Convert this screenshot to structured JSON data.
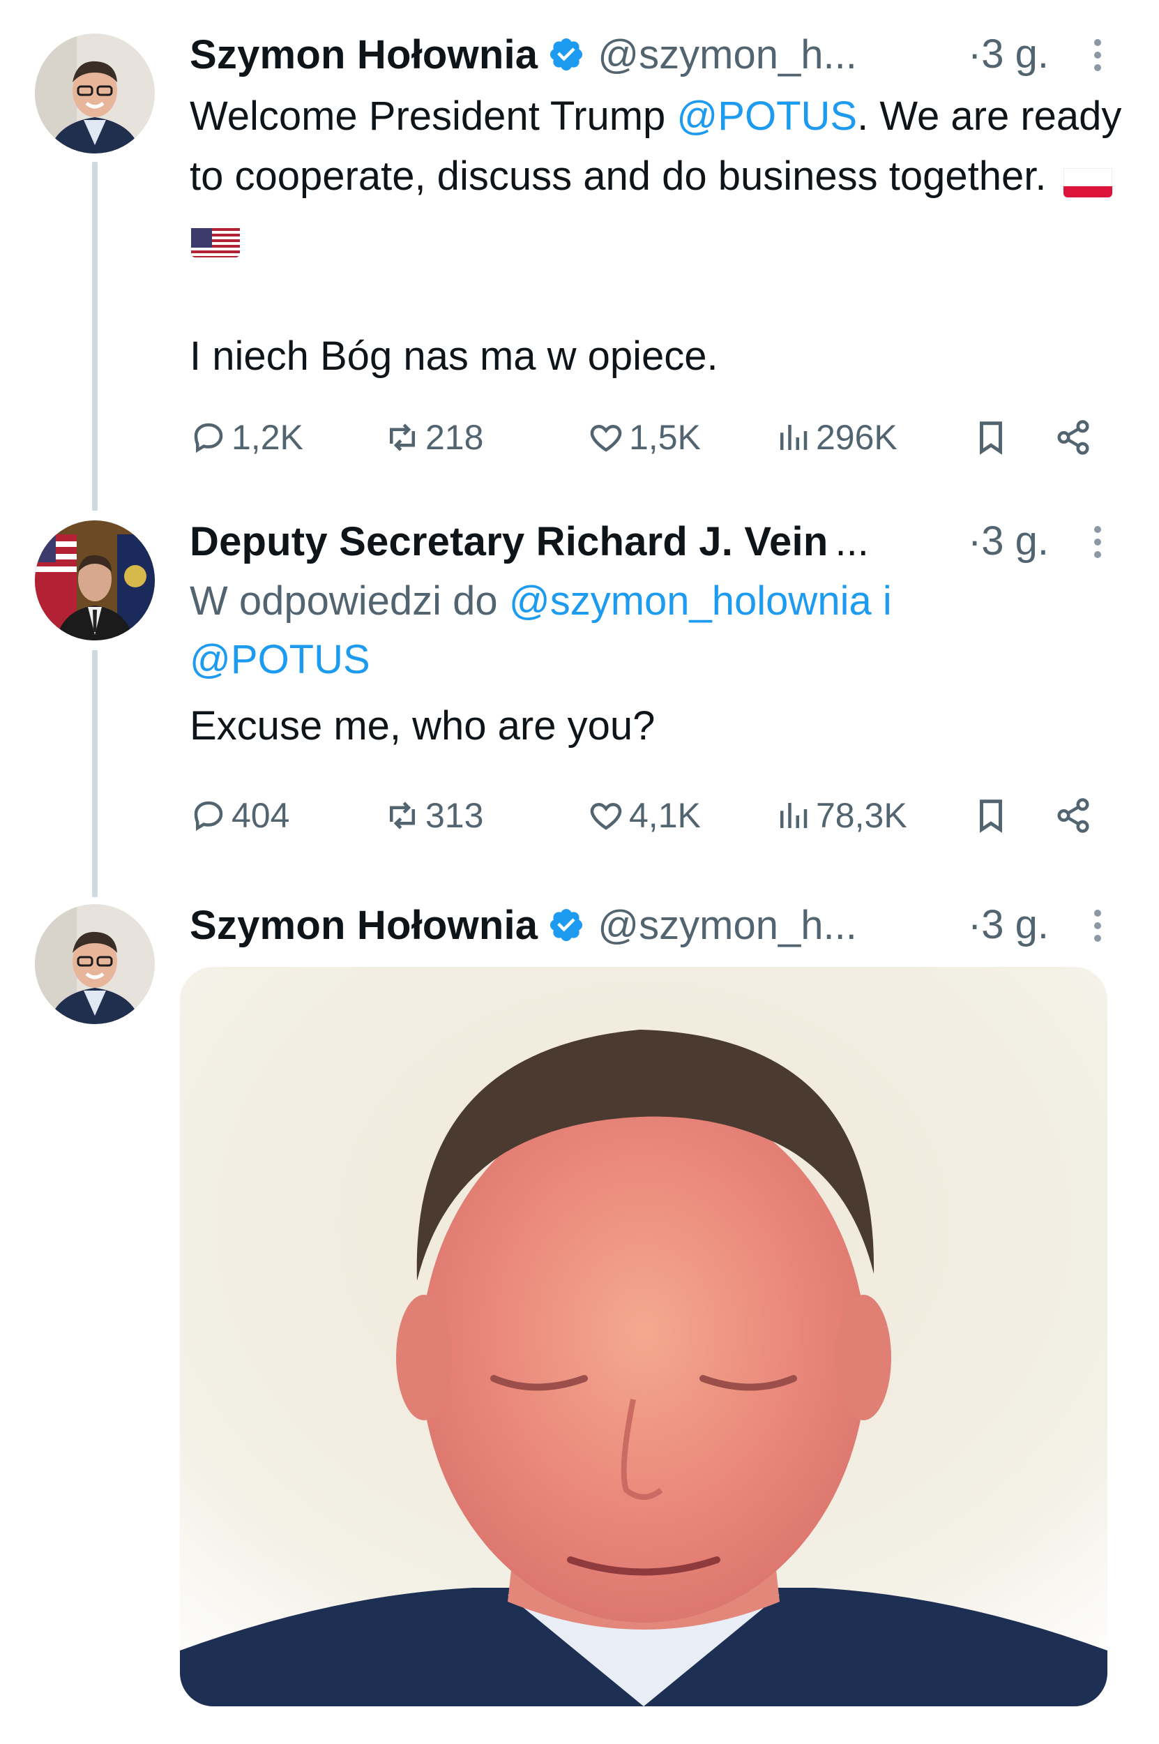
{
  "tweets": [
    {
      "author": "Szymon Hołownia",
      "handle": "@szymon_h...",
      "time": "·3 g.",
      "text_part1": "Welcome President Trump ",
      "mention": "@POTUS",
      "text_part2": ". We are ready to cooperate, discuss and do business together.",
      "text_line2": "I niech Bóg nas ma w opiece.",
      "stats": {
        "replies": "1,2K",
        "retweets": "218",
        "likes": "1,5K",
        "views": "296K"
      }
    },
    {
      "author": "Deputy Secretary Richard J. Vein",
      "ellipsis": "...",
      "time": "·3 g.",
      "reply_prefix": "W odpowiedzi do ",
      "reply_mention1": "@szymon_holownia",
      "reply_and": " i",
      "reply_mention2": "@POTUS",
      "text": "Excuse me, who are you?",
      "stats": {
        "replies": "404",
        "retweets": "313",
        "likes": "4,1K",
        "views": "78,3K"
      }
    },
    {
      "author": "Szymon Hołownia",
      "handle": "@szymon_h...",
      "time": "·3 g."
    }
  ],
  "colors": {
    "link": "#1d9bf0",
    "muted": "#536471",
    "verified": "#1d9bf0",
    "thread_line": "#cfd9de"
  },
  "icons": [
    "verified-badge-icon",
    "more-icon",
    "reply-icon",
    "retweet-icon",
    "like-icon",
    "views-icon",
    "bookmark-icon",
    "share-icon",
    "poland-flag-icon",
    "usa-flag-icon"
  ]
}
